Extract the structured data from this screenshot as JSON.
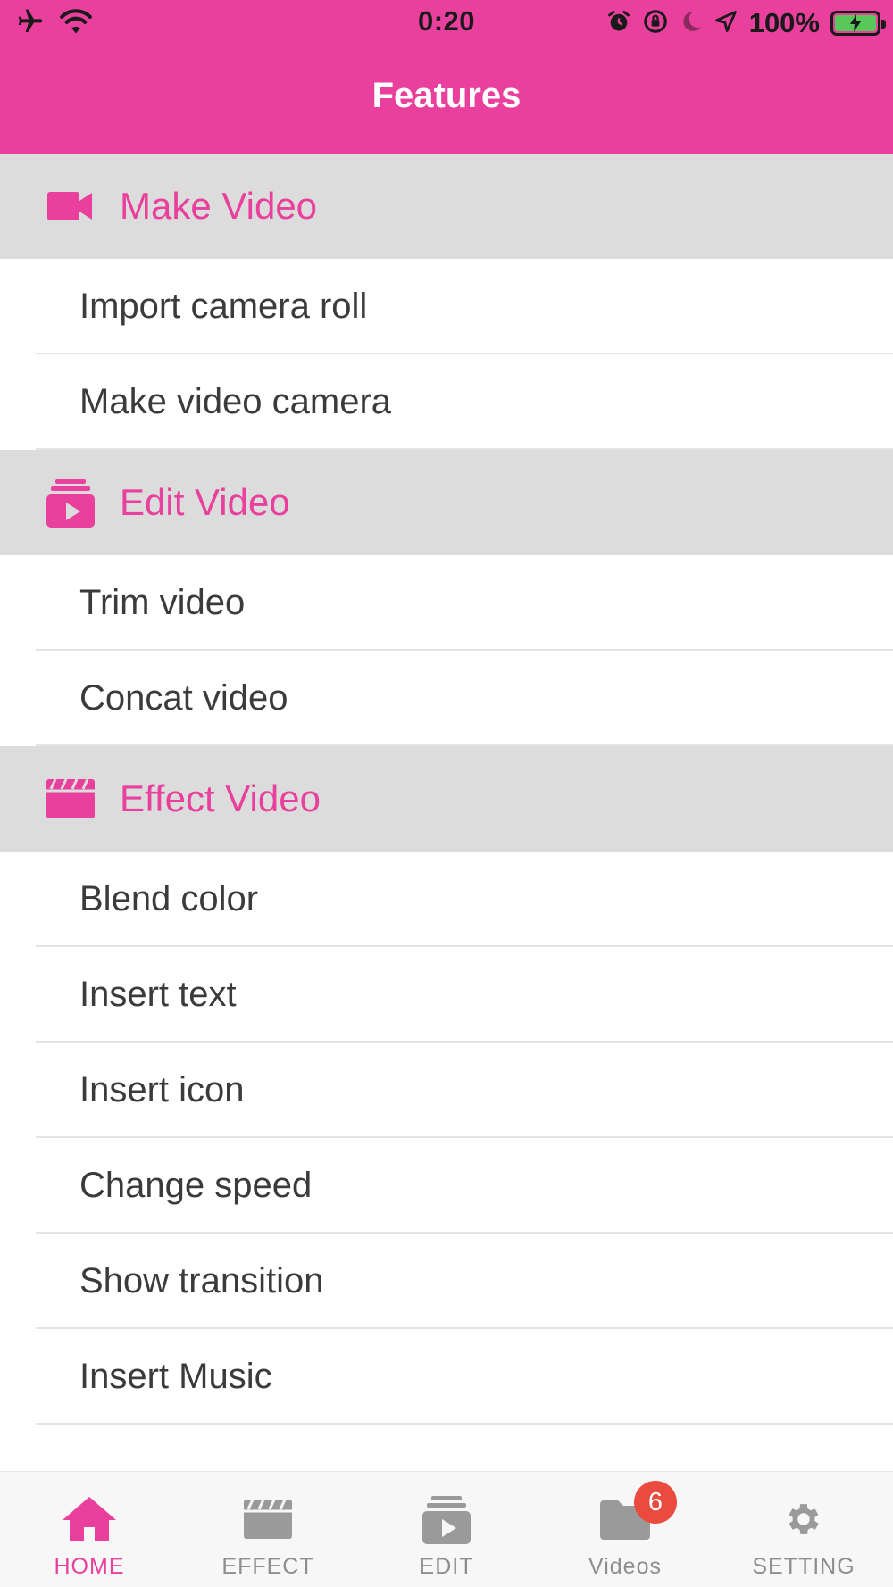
{
  "status_bar": {
    "time": "0:20",
    "battery_percent": "100%",
    "battery_level": 1.0,
    "icons": [
      "airplane-icon",
      "wifi-icon",
      "alarm-icon",
      "orientation-lock-icon",
      "moon-icon",
      "location-icon",
      "battery-icon"
    ]
  },
  "header": {
    "title": "Features"
  },
  "colors": {
    "accent": "#E8409C",
    "section_bg": "#DCDCDC",
    "badge": "#EA4B3E",
    "tab_inactive": "#8E8E8E"
  },
  "sections": [
    {
      "title": "Make Video",
      "icon": "video-camera-icon",
      "items": [
        "Import camera roll",
        "Make video camera"
      ]
    },
    {
      "title": "Edit Video",
      "icon": "video-stack-icon",
      "items": [
        "Trim video",
        "Concat video"
      ]
    },
    {
      "title": "Effect Video",
      "icon": "clapperboard-icon",
      "items": [
        "Blend color",
        "Insert text",
        "Insert icon",
        "Change speed",
        "Show transition",
        "Insert Music"
      ]
    }
  ],
  "tabbar": {
    "tabs": [
      {
        "label": "HOME",
        "icon": "home-icon",
        "active": true
      },
      {
        "label": "EFFECT",
        "icon": "clapperboard-icon",
        "active": false
      },
      {
        "label": "EDIT",
        "icon": "video-stack-icon",
        "active": false
      },
      {
        "label": "Videos",
        "icon": "folder-icon",
        "active": false,
        "badge": "6"
      },
      {
        "label": "SETTING",
        "icon": "gear-icon",
        "active": false
      }
    ]
  }
}
